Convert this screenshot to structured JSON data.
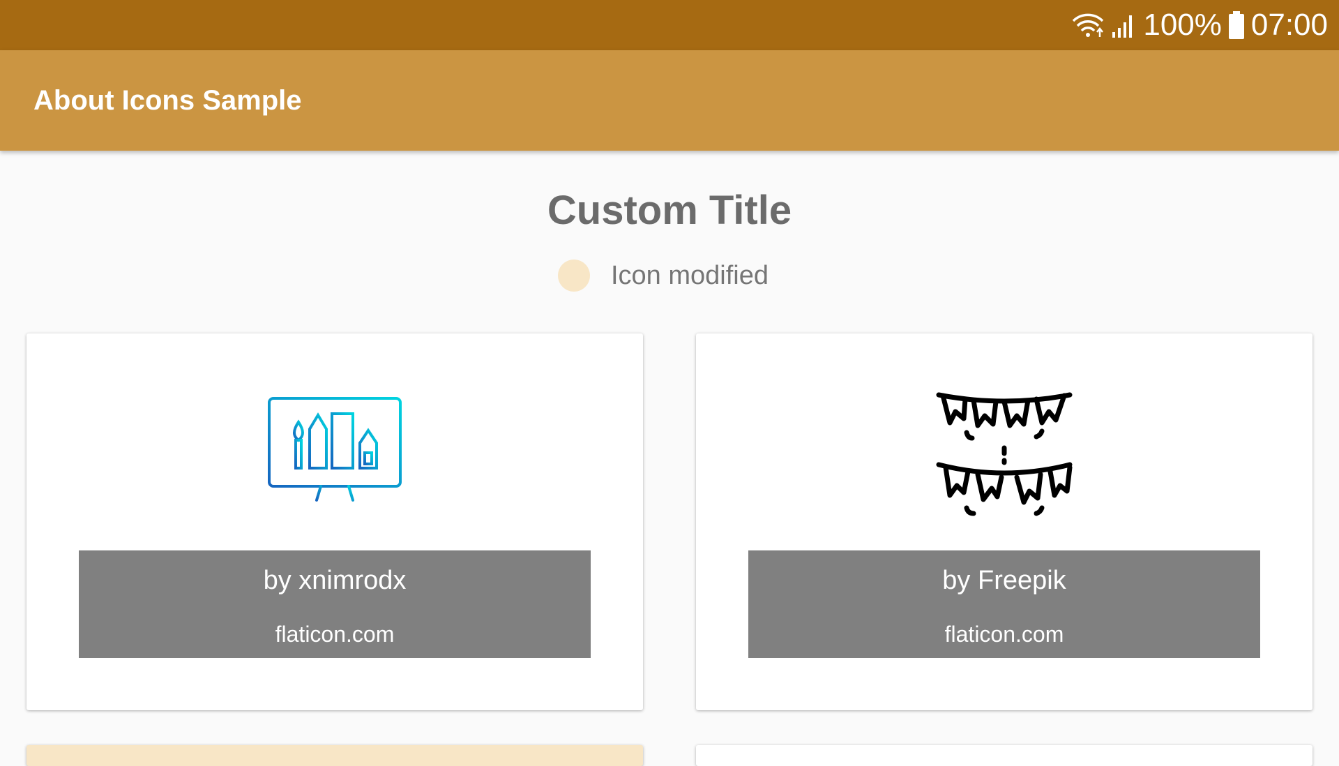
{
  "status_bar": {
    "battery": "100%",
    "time": "07:00",
    "icons": [
      "wifi-icon",
      "signal-icon",
      "battery-icon"
    ]
  },
  "app_bar": {
    "title": "About Icons Sample"
  },
  "content": {
    "title": "Custom Title",
    "modified_label": "Icon modified",
    "cards": [
      {
        "icon": "monitor-art-tools-icon",
        "author": "by xnimrodx",
        "site": "flaticon.com"
      },
      {
        "icon": "party-bunting-icon",
        "author": "by Freepik",
        "site": "flaticon.com"
      }
    ]
  },
  "colors": {
    "status_bar": "#a66a12",
    "app_bar": "#cb9542",
    "modified_dot": "#f8e6c6",
    "credit_background": "#808080"
  }
}
